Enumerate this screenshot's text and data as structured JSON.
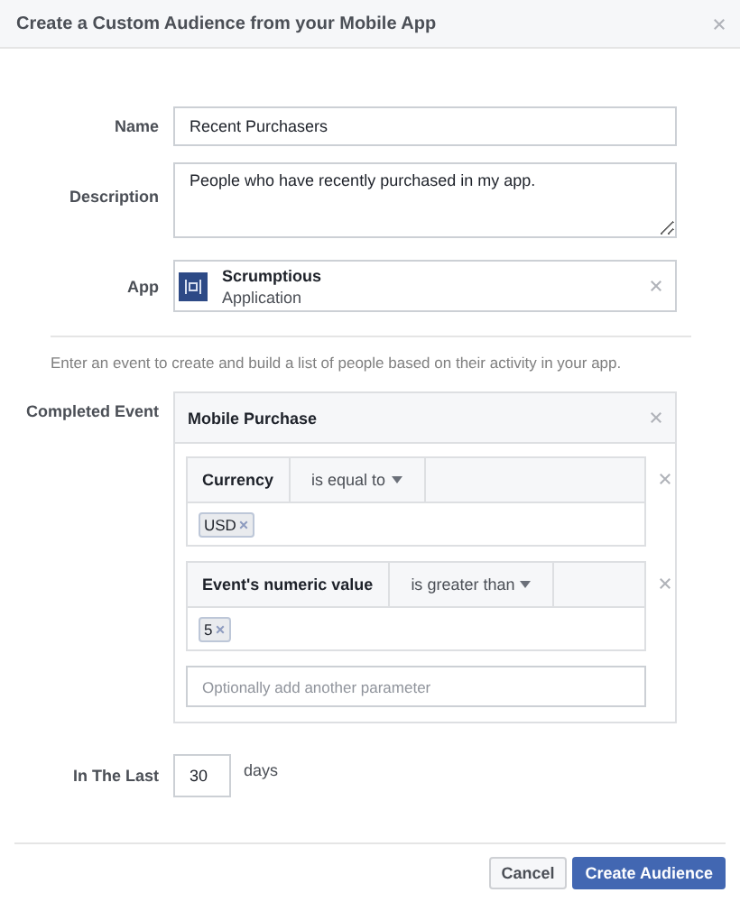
{
  "dialog": {
    "title": "Create a Custom Audience from your Mobile App",
    "fields": [
      {
        "kind": "text",
        "label": "Name",
        "value": "Recent Purchasers"
      },
      {
        "kind": "textarea",
        "label": "Description",
        "value": "People who have recently purchased in my app."
      },
      {
        "kind": "app",
        "label": "App",
        "app_name": "Scrumptious",
        "app_type": "Application"
      }
    ],
    "hint": "Enter an event to create and build a list of people based on their activity in your app.",
    "event": {
      "label": "Completed Event",
      "name": "Mobile Purchase",
      "parameters": [
        {
          "name": "Currency",
          "operator": "is equal to",
          "tokens": [
            "USD"
          ]
        },
        {
          "name": "Event's numeric value",
          "operator": "is greater than",
          "tokens": [
            "5"
          ]
        }
      ],
      "add_placeholder": "Optionally add another parameter"
    },
    "period": {
      "label": "In The Last",
      "value": "30",
      "unit": "days"
    },
    "buttons": [
      {
        "label": "Cancel",
        "kind": "secondary"
      },
      {
        "label": "Create Audience",
        "kind": "primary"
      }
    ]
  }
}
